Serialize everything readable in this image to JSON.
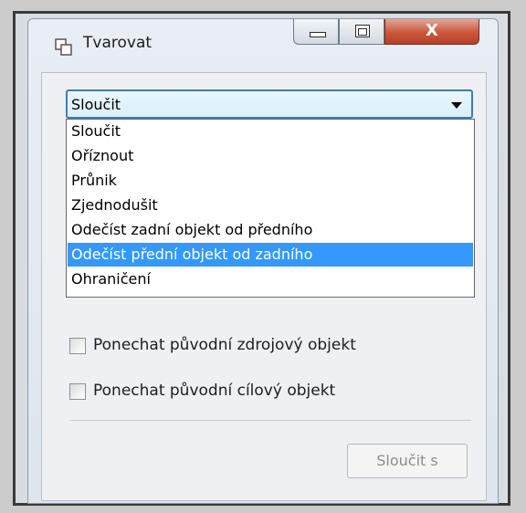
{
  "window": {
    "title": "Tvarovat",
    "close_glyph": "X",
    "icon": "shape-combine-icon"
  },
  "combo": {
    "selected": "Sloučit"
  },
  "dropdown": {
    "items": [
      "Sloučit",
      "Oříznout",
      "Průnik",
      "Zjednodušit",
      "Odečíst zadní objekt od předního",
      "Odečíst přední objekt od zadního",
      "Ohraničení"
    ],
    "highlighted": "Odečíst přední objekt od zadního"
  },
  "options": {
    "keep_source_label": "Ponechat původní zdrojový objekt",
    "keep_source_checked": false,
    "keep_target_label": "Ponechat původní cílový objekt",
    "keep_target_checked": false
  },
  "actions": {
    "merge_with_label": "Sloučit s"
  },
  "colors": {
    "selection": "#3399ff",
    "combo_border": "#3c7fb1",
    "close_button": "#c9563c"
  }
}
